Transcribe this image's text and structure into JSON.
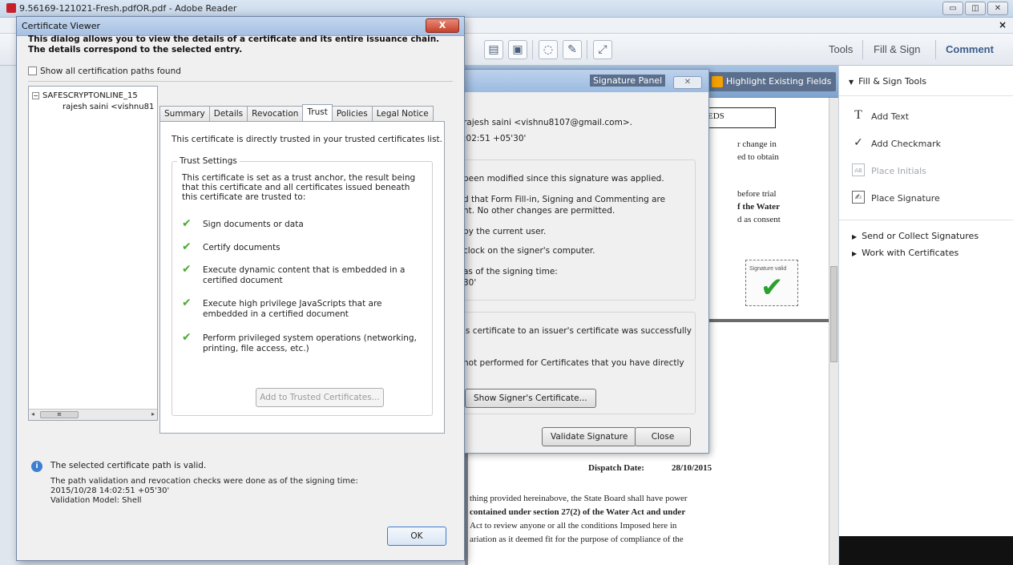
{
  "app": {
    "title": "9.56169-121021-Fresh.pdfOR.pdf - Adobe Reader",
    "window_controls": [
      "▭",
      "◫",
      "✕"
    ],
    "menu_close": "×"
  },
  "toolbar": {
    "tools": "Tools",
    "fill_sign": "Fill & Sign",
    "comment": "Comment"
  },
  "right_pane": {
    "header": "Fill & Sign Tools",
    "items": [
      {
        "label": "Add Text",
        "enabled": true
      },
      {
        "label": "Add Checkmark",
        "enabled": true
      },
      {
        "label": "Place Initials",
        "enabled": false
      },
      {
        "label": "Place Signature",
        "enabled": true
      }
    ],
    "sections": [
      "Send or Collect Signatures",
      "Work with Certificates"
    ]
  },
  "doc": {
    "highlight_button": "Highlight Existing Fields",
    "eds": "EDS",
    "top_lines": [
      "r change in",
      "ed to obtain",
      "before trial",
      "f the Water",
      "d as consent"
    ],
    "signature_stamp": "Signature valid",
    "dispatch_label": "Dispatch Date:",
    "dispatch_date": "28/10/2015",
    "bottom_lines": [
      "thing provided hereinabove, the State Board shall have power",
      "contained under section 27(2) of the Water Act and under",
      "Act to review anyone or all the conditions Imposed here in",
      "ariation as it deemed fit for the purpose of compliance of the"
    ]
  },
  "sig_props": {
    "title_fragment": "Signature Panel",
    "lines": [
      "rajesh saini <vishnu8107@gmail.com>.",
      ":02:51 +05'30'",
      "been modified since this signature was applied.",
      "d that Form Fill-in, Signing and Commenting are",
      "nt. No other changes are permitted.",
      "by the current user.",
      "clock on the signer's computer.",
      "as of the signing time:",
      "30'",
      "'s certificate to an issuer's certificate was successfully",
      "not performed for Certificates that you have directly"
    ],
    "show_cert_button": "Show Signer's Certificate...",
    "validate_button": "Validate Signature",
    "close_button": "Close"
  },
  "cert_viewer": {
    "title": "Certificate Viewer",
    "close": "X",
    "intro": "This dialog allows you to view the details of a certificate and its entire issuance chain. The details correspond to the selected entry.",
    "show_all_paths": "Show all certification paths found",
    "tree": {
      "root": "SAFESCRYPTONLINE_15",
      "child": "rajesh saini <vishnu81"
    },
    "tabs": [
      "Summary",
      "Details",
      "Revocation",
      "Trust",
      "Policies",
      "Legal Notice"
    ],
    "active_tab": "Trust",
    "trusted_text": "This certificate is directly trusted in your trusted certificates list.",
    "trust_settings_label": "Trust Settings",
    "trust_settings_desc": "This certificate is set as a trust anchor, the result being that this certificate and all certificates issued beneath this certificate are trusted to:",
    "trust_items": [
      "Sign documents or data",
      "Certify documents",
      "Execute dynamic content that is embedded in a certified document",
      "Execute high privilege JavaScripts that are embedded in a certified document",
      "Perform privileged system operations (networking, printing, file access, etc.)"
    ],
    "add_trusted_button": "Add to Trusted Certificates...",
    "status_valid": "The selected certificate path is valid.",
    "status_detail": [
      "The path validation and revocation checks were done as of the signing time:",
      "2015/10/28 14:02:51 +05'30'",
      "Validation Model: Shell"
    ],
    "ok_button": "OK"
  }
}
